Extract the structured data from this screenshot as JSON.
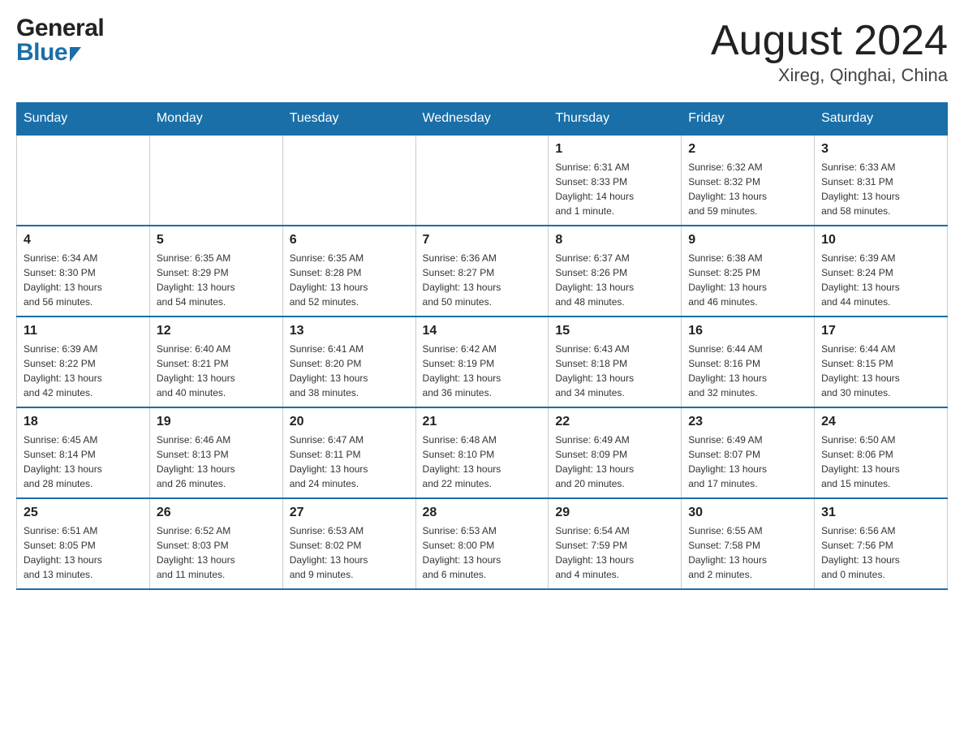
{
  "header": {
    "logo_general": "General",
    "logo_blue": "Blue",
    "month_title": "August 2024",
    "location": "Xireg, Qinghai, China"
  },
  "weekdays": [
    "Sunday",
    "Monday",
    "Tuesday",
    "Wednesday",
    "Thursday",
    "Friday",
    "Saturday"
  ],
  "weeks": [
    {
      "days": [
        {
          "num": "",
          "info": ""
        },
        {
          "num": "",
          "info": ""
        },
        {
          "num": "",
          "info": ""
        },
        {
          "num": "",
          "info": ""
        },
        {
          "num": "1",
          "info": "Sunrise: 6:31 AM\nSunset: 8:33 PM\nDaylight: 14 hours\nand 1 minute."
        },
        {
          "num": "2",
          "info": "Sunrise: 6:32 AM\nSunset: 8:32 PM\nDaylight: 13 hours\nand 59 minutes."
        },
        {
          "num": "3",
          "info": "Sunrise: 6:33 AM\nSunset: 8:31 PM\nDaylight: 13 hours\nand 58 minutes."
        }
      ]
    },
    {
      "days": [
        {
          "num": "4",
          "info": "Sunrise: 6:34 AM\nSunset: 8:30 PM\nDaylight: 13 hours\nand 56 minutes."
        },
        {
          "num": "5",
          "info": "Sunrise: 6:35 AM\nSunset: 8:29 PM\nDaylight: 13 hours\nand 54 minutes."
        },
        {
          "num": "6",
          "info": "Sunrise: 6:35 AM\nSunset: 8:28 PM\nDaylight: 13 hours\nand 52 minutes."
        },
        {
          "num": "7",
          "info": "Sunrise: 6:36 AM\nSunset: 8:27 PM\nDaylight: 13 hours\nand 50 minutes."
        },
        {
          "num": "8",
          "info": "Sunrise: 6:37 AM\nSunset: 8:26 PM\nDaylight: 13 hours\nand 48 minutes."
        },
        {
          "num": "9",
          "info": "Sunrise: 6:38 AM\nSunset: 8:25 PM\nDaylight: 13 hours\nand 46 minutes."
        },
        {
          "num": "10",
          "info": "Sunrise: 6:39 AM\nSunset: 8:24 PM\nDaylight: 13 hours\nand 44 minutes."
        }
      ]
    },
    {
      "days": [
        {
          "num": "11",
          "info": "Sunrise: 6:39 AM\nSunset: 8:22 PM\nDaylight: 13 hours\nand 42 minutes."
        },
        {
          "num": "12",
          "info": "Sunrise: 6:40 AM\nSunset: 8:21 PM\nDaylight: 13 hours\nand 40 minutes."
        },
        {
          "num": "13",
          "info": "Sunrise: 6:41 AM\nSunset: 8:20 PM\nDaylight: 13 hours\nand 38 minutes."
        },
        {
          "num": "14",
          "info": "Sunrise: 6:42 AM\nSunset: 8:19 PM\nDaylight: 13 hours\nand 36 minutes."
        },
        {
          "num": "15",
          "info": "Sunrise: 6:43 AM\nSunset: 8:18 PM\nDaylight: 13 hours\nand 34 minutes."
        },
        {
          "num": "16",
          "info": "Sunrise: 6:44 AM\nSunset: 8:16 PM\nDaylight: 13 hours\nand 32 minutes."
        },
        {
          "num": "17",
          "info": "Sunrise: 6:44 AM\nSunset: 8:15 PM\nDaylight: 13 hours\nand 30 minutes."
        }
      ]
    },
    {
      "days": [
        {
          "num": "18",
          "info": "Sunrise: 6:45 AM\nSunset: 8:14 PM\nDaylight: 13 hours\nand 28 minutes."
        },
        {
          "num": "19",
          "info": "Sunrise: 6:46 AM\nSunset: 8:13 PM\nDaylight: 13 hours\nand 26 minutes."
        },
        {
          "num": "20",
          "info": "Sunrise: 6:47 AM\nSunset: 8:11 PM\nDaylight: 13 hours\nand 24 minutes."
        },
        {
          "num": "21",
          "info": "Sunrise: 6:48 AM\nSunset: 8:10 PM\nDaylight: 13 hours\nand 22 minutes."
        },
        {
          "num": "22",
          "info": "Sunrise: 6:49 AM\nSunset: 8:09 PM\nDaylight: 13 hours\nand 20 minutes."
        },
        {
          "num": "23",
          "info": "Sunrise: 6:49 AM\nSunset: 8:07 PM\nDaylight: 13 hours\nand 17 minutes."
        },
        {
          "num": "24",
          "info": "Sunrise: 6:50 AM\nSunset: 8:06 PM\nDaylight: 13 hours\nand 15 minutes."
        }
      ]
    },
    {
      "days": [
        {
          "num": "25",
          "info": "Sunrise: 6:51 AM\nSunset: 8:05 PM\nDaylight: 13 hours\nand 13 minutes."
        },
        {
          "num": "26",
          "info": "Sunrise: 6:52 AM\nSunset: 8:03 PM\nDaylight: 13 hours\nand 11 minutes."
        },
        {
          "num": "27",
          "info": "Sunrise: 6:53 AM\nSunset: 8:02 PM\nDaylight: 13 hours\nand 9 minutes."
        },
        {
          "num": "28",
          "info": "Sunrise: 6:53 AM\nSunset: 8:00 PM\nDaylight: 13 hours\nand 6 minutes."
        },
        {
          "num": "29",
          "info": "Sunrise: 6:54 AM\nSunset: 7:59 PM\nDaylight: 13 hours\nand 4 minutes."
        },
        {
          "num": "30",
          "info": "Sunrise: 6:55 AM\nSunset: 7:58 PM\nDaylight: 13 hours\nand 2 minutes."
        },
        {
          "num": "31",
          "info": "Sunrise: 6:56 AM\nSunset: 7:56 PM\nDaylight: 13 hours\nand 0 minutes."
        }
      ]
    }
  ]
}
